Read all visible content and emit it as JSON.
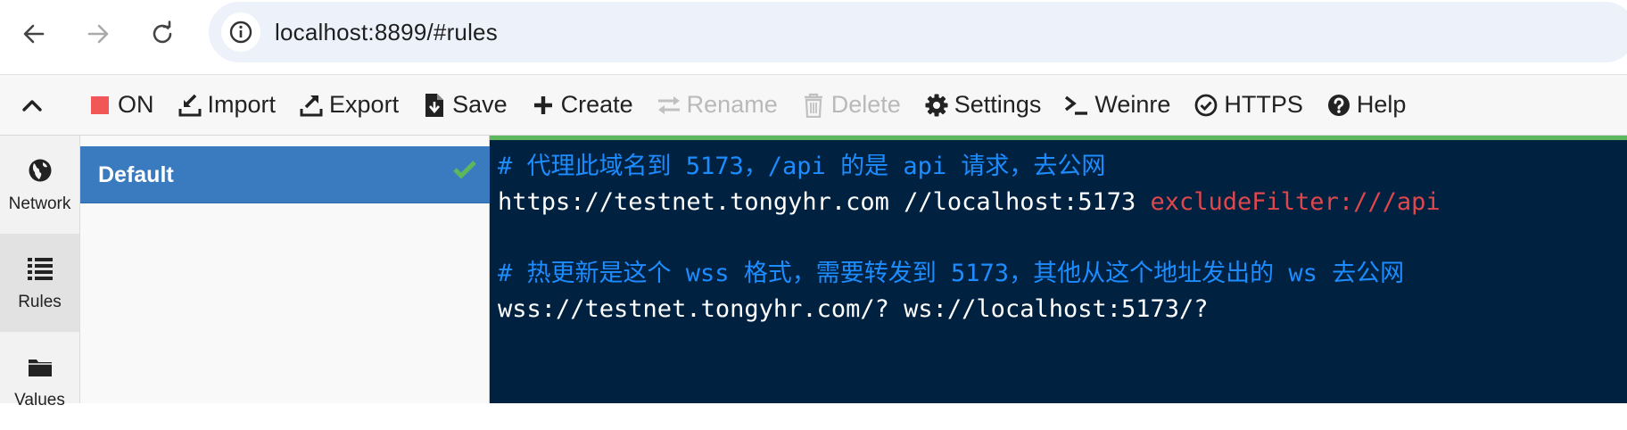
{
  "browser": {
    "url": "localhost:8899/#rules"
  },
  "toolbar": {
    "items": [
      {
        "label": "ON",
        "icon": "stop-square-icon",
        "disabled": false
      },
      {
        "label": "Import",
        "icon": "import-icon",
        "disabled": false
      },
      {
        "label": "Export",
        "icon": "export-icon",
        "disabled": false
      },
      {
        "label": "Save",
        "icon": "save-file-icon",
        "disabled": false
      },
      {
        "label": "Create",
        "icon": "plus-icon",
        "disabled": false
      },
      {
        "label": "Rename",
        "icon": "swap-arrows-icon",
        "disabled": true
      },
      {
        "label": "Delete",
        "icon": "trash-icon",
        "disabled": true
      },
      {
        "label": "Settings",
        "icon": "gear-icon",
        "disabled": false
      },
      {
        "label": "Weinre",
        "icon": "terminal-icon",
        "disabled": false
      },
      {
        "label": "HTTPS",
        "icon": "check-circle-icon",
        "disabled": false
      },
      {
        "label": "Help",
        "icon": "question-circle-icon",
        "disabled": false
      }
    ]
  },
  "rail": {
    "network": "Network",
    "rules": "Rules",
    "values": "Values"
  },
  "rules": {
    "items": [
      {
        "name": "Default",
        "active": true
      }
    ]
  },
  "editor": {
    "lines": [
      {
        "segments": [
          {
            "text": "# 代理此域名到 5173，/api 的是 api 请求，去公网",
            "kind": "comment"
          }
        ]
      },
      {
        "segments": [
          {
            "text": "https://testnet.tongyhr.com //localhost:5173 ",
            "kind": "plain"
          },
          {
            "text": "excludeFilter:///api",
            "kind": "keyword"
          }
        ]
      },
      {
        "segments": [
          {
            "text": "",
            "kind": "plain"
          }
        ]
      },
      {
        "segments": [
          {
            "text": "# 热更新是这个 wss 格式，需要转发到 5173，其他从这个地址发出的 ws 去公网",
            "kind": "comment"
          }
        ]
      },
      {
        "segments": [
          {
            "text": "wss://testnet.tongyhr.com/? ws://localhost:5173/?",
            "kind": "plain"
          }
        ]
      }
    ]
  },
  "colors": {
    "toolbar_on": "#f25757",
    "active_rule_bg": "#3a7bbf",
    "check": "#5cb85c",
    "editor_bg": "#002240",
    "comment": "#1d8cff",
    "keyword": "#e0474c",
    "disabled_text": "#b9b9b9"
  }
}
